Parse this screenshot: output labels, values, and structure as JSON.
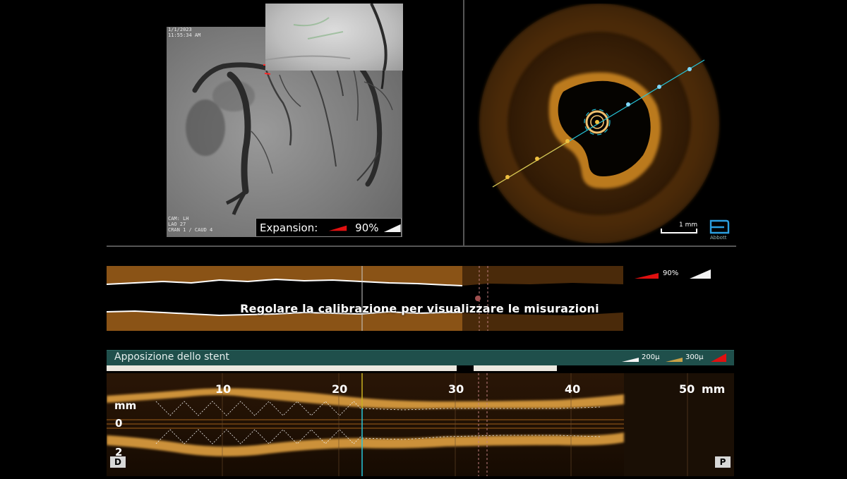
{
  "angiography": {
    "header_text": [
      "1/1/2023",
      "11:55:34 AM"
    ],
    "footer_text": [
      "CAM: LH",
      "LAO 27",
      "CRAN 1 / CAUD 4"
    ],
    "expansion_label": "Expansion:",
    "expansion_value": "90%"
  },
  "oct_view": {
    "scale_label": "1 mm",
    "brand": "Abbott"
  },
  "lumen_profile": {
    "message": "Regolare la calibrazione per visualizzare le misurazioni",
    "legend_value": "90%"
  },
  "apposition": {
    "title": "Apposizione dello stent",
    "legend_200": "200µ",
    "legend_300": "300µ",
    "colors": {
      "bar": "#1f4f4b",
      "tan": "#c8a046",
      "red": "#e01010"
    }
  },
  "lmode": {
    "ticks": [
      "10",
      "20",
      "30",
      "40",
      "50"
    ],
    "unit": "mm",
    "y_unit": "mm",
    "y_labels": [
      "0",
      "2"
    ],
    "distal_label": "D",
    "proximal_label": "P"
  },
  "colors": {
    "accent_cyan": "#26c6da",
    "oct_gold": "#e6a032",
    "lumen_orange": "#8a5316"
  }
}
